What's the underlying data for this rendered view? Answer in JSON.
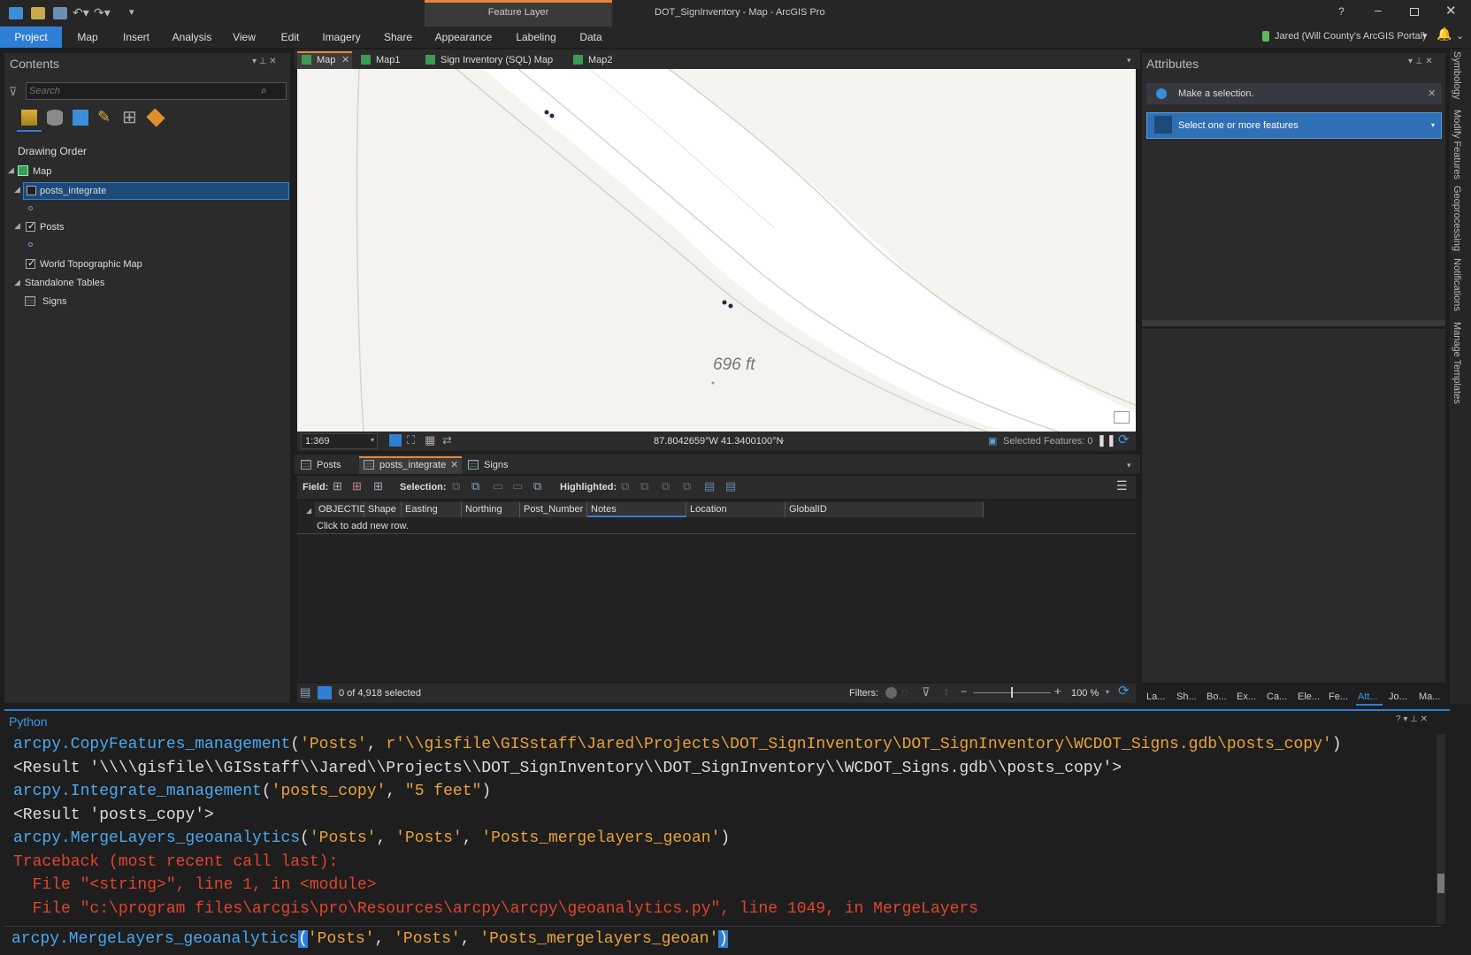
{
  "window": {
    "title": "DOT_SignInventory - Map - ArcGIS Pro",
    "context_tab_group": "Feature Layer",
    "help": "?",
    "user": "Jared (Will County's ArcGIS Portal)"
  },
  "ribbon_tabs": [
    "Project",
    "Map",
    "Insert",
    "Analysis",
    "View",
    "Edit",
    "Imagery",
    "Share",
    "Appearance",
    "Labeling",
    "Data"
  ],
  "contents": {
    "title": "Contents",
    "search_placeholder": "Search",
    "drawing_order": "Drawing Order",
    "map_label": "Map",
    "layers": [
      "posts_integrate",
      "Posts",
      "World Topographic Map"
    ],
    "standalone_tables": "Standalone Tables",
    "table_signs": "Signs"
  },
  "map_tabs": [
    "Map",
    "Map1",
    "Sign Inventory (SQL) Map",
    "Map2"
  ],
  "map_view": {
    "distance_label": "696 ft",
    "scale": "1:369",
    "coords": "87.8042659°W 41.3400100°N",
    "selected_features": "Selected Features: 0"
  },
  "table_tabs": [
    "Posts",
    "posts_integrate",
    "Signs"
  ],
  "table_toolbar": {
    "field": "Field:",
    "selection": "Selection:",
    "highlighted": "Highlighted:"
  },
  "table_columns": [
    "OBJECTID",
    "Shape",
    "Easting",
    "Northing",
    "Post_Number",
    "Notes",
    "Location",
    "GlobalID"
  ],
  "table_add_row": "Click to add new row.",
  "table_footer": {
    "selected": "0 of 4,918 selected",
    "filters": "Filters:",
    "zoom": "100 %"
  },
  "attributes": {
    "title": "Attributes",
    "message": "Make a selection.",
    "dropdown": "Select one or more features"
  },
  "side_tabs": [
    "Symbology",
    "Modify Features",
    "Geoprocessing",
    "Notifications",
    "Manage Templates"
  ],
  "bottom_tabs": [
    "La...",
    "Sh...",
    "Bo...",
    "Ex...",
    "Ca...",
    "Ele...",
    "Fe...",
    "Att...",
    "Jo...",
    "Ma..."
  ],
  "python": {
    "title": "Python",
    "lines": [
      {
        "parts": [
          [
            "fn",
            "arcpy.CopyFeatures_management"
          ],
          [
            "p",
            "("
          ],
          [
            "s",
            "'Posts'"
          ],
          [
            "p",
            ", "
          ],
          [
            "s",
            "r'\\\\gisfile\\GISstaff\\Jared\\Projects\\DOT_SignInventory\\DOT_SignInventory\\WCDOT_Signs.gdb\\posts_copy'"
          ],
          [
            "p",
            ")"
          ]
        ]
      },
      {
        "parts": [
          [
            "w",
            "<Result '\\\\\\\\gisfile\\\\GISstaff\\\\Jared\\\\Projects\\\\DOT_SignInventory\\\\DOT_SignInventory\\\\WCDOT_Signs.gdb\\\\posts_copy'>"
          ]
        ]
      },
      {
        "parts": [
          [
            "fn",
            "arcpy.Integrate_management"
          ],
          [
            "p",
            "("
          ],
          [
            "s",
            "'posts_copy'"
          ],
          [
            "p",
            ", "
          ],
          [
            "s",
            "\"5 feet\""
          ],
          [
            "p",
            ")"
          ]
        ]
      },
      {
        "parts": [
          [
            "w",
            "<Result 'posts_copy'>"
          ]
        ]
      },
      {
        "parts": [
          [
            "fn",
            "arcpy.MergeLayers_geoanalytics"
          ],
          [
            "p",
            "("
          ],
          [
            "s",
            "'Posts'"
          ],
          [
            "p",
            ", "
          ],
          [
            "s",
            "'Posts'"
          ],
          [
            "p",
            ", "
          ],
          [
            "s",
            "'Posts_mergelayers_geoan'"
          ],
          [
            "p",
            ")"
          ]
        ]
      },
      {
        "parts": [
          [
            "e",
            "Traceback (most recent call last):"
          ]
        ]
      },
      {
        "parts": [
          [
            "e",
            "  File \"<string>\", line 1, in <module>"
          ]
        ]
      },
      {
        "parts": [
          [
            "e",
            "  File \"c:\\program files\\arcgis\\pro\\Resources\\arcpy\\arcpy\\geoanalytics.py\", line 1049, in MergeLayers"
          ]
        ]
      }
    ],
    "input": {
      "parts": [
        [
          "fn",
          "arcpy.MergeLayers_geoanalytics"
        ],
        [
          "hl",
          "("
        ],
        [
          "s",
          "'Posts'"
        ],
        [
          "p",
          ", "
        ],
        [
          "s",
          "'Posts'"
        ],
        [
          "p",
          ", "
        ],
        [
          "s",
          "'Posts_mergelayers_geoan'"
        ],
        [
          "hl",
          ")"
        ]
      ]
    }
  },
  "colors": {
    "accent": "#2f7fd6",
    "string": "#e8a33a",
    "function": "#4aa8f0",
    "error": "#e0452d"
  }
}
